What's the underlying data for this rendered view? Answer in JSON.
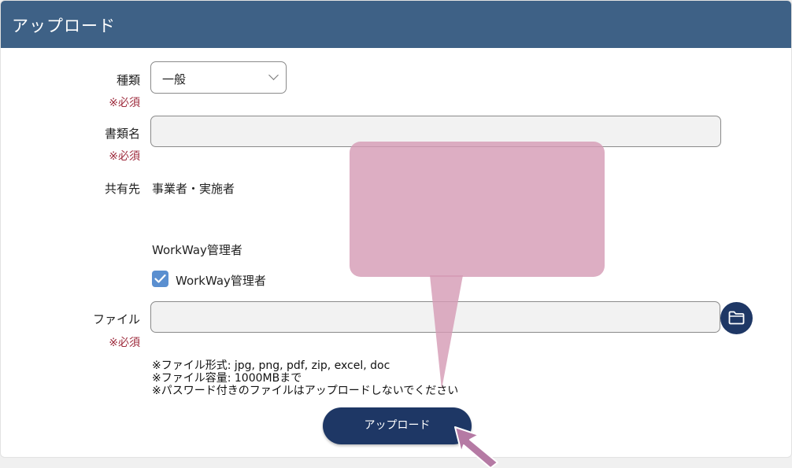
{
  "header": {
    "title": "アップロード"
  },
  "form": {
    "type": {
      "label": "種類",
      "required": "※必須",
      "value": "一般"
    },
    "doc_name": {
      "label": "書類名",
      "required": "※必須",
      "value": ""
    },
    "share": {
      "label": "共有先",
      "value": "事業者・実施者",
      "group_label": "WorkWay管理者",
      "checkbox_label": "WorkWay管理者",
      "checked": true
    },
    "file": {
      "label": "ファイル",
      "required": "※必須",
      "value": ""
    },
    "notes": [
      "※ファイル形式: jpg, png, pdf, zip, excel, doc",
      "※ファイル容量: 1000MBまで",
      "※パスワード付きのファイルはアップロードしないでください"
    ],
    "upload_label": "アップロード"
  },
  "colors": {
    "header": "#3e6186",
    "button": "#1e3765",
    "required": "#9e2b3d",
    "checkbox": "#5a8fd0",
    "callout": "#d59ab4",
    "arrow": "#b57aa4"
  },
  "icons": {
    "folder": "folder-icon",
    "chevron": "chevron-down-icon",
    "check": "check-icon"
  }
}
